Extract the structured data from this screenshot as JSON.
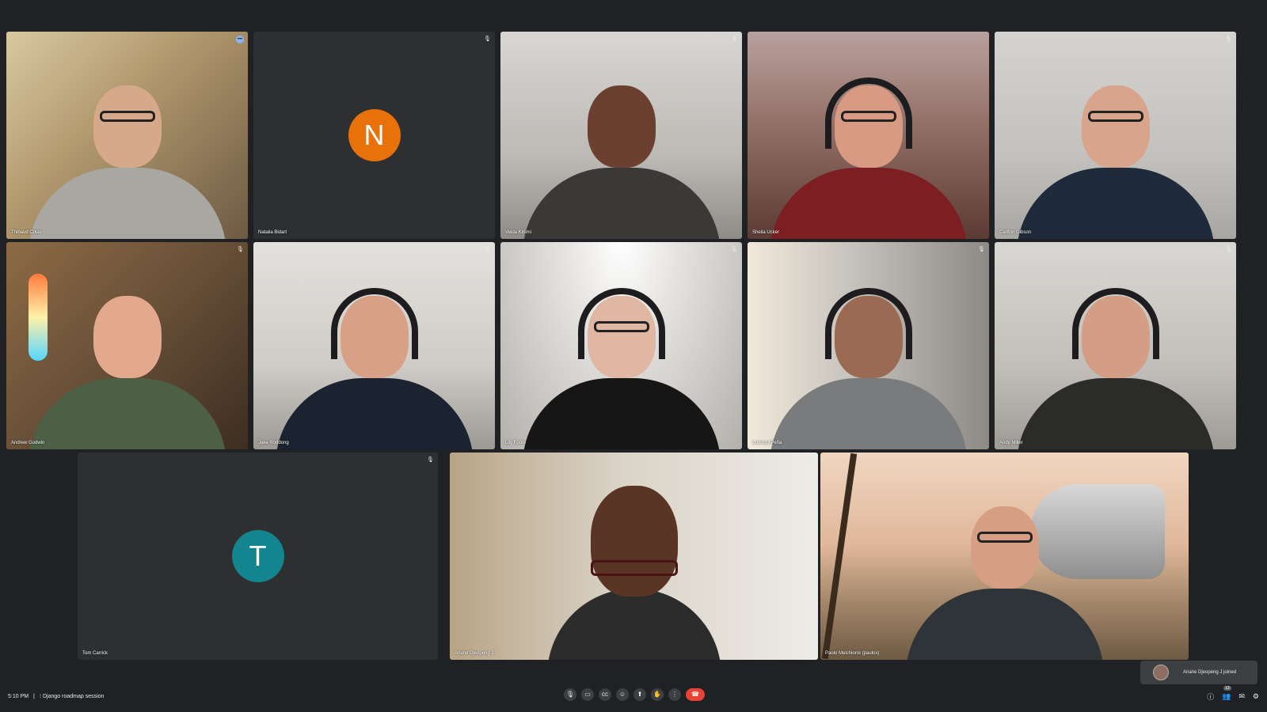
{
  "meeting": {
    "time": "5:10 PM",
    "separator": "|",
    "title": "Django roadmap session"
  },
  "participants": [
    {
      "name": "Thibaud Colas",
      "video": true
    },
    {
      "name": "Natalia Bidart",
      "video": false,
      "initial": "N",
      "avatar_color": "#e8710a"
    },
    {
      "name": "Velda Kiriimi",
      "video": true
    },
    {
      "name": "Sheila Ucker",
      "video": true
    },
    {
      "name": "Carlton Gibson",
      "video": true
    },
    {
      "name": "Andrew Godwin",
      "video": true
    },
    {
      "name": "Jake Roddong",
      "video": true
    },
    {
      "name": "Lily Foote",
      "video": true
    },
    {
      "name": "Lorenzo Peña",
      "video": true
    },
    {
      "name": "Andy Miller",
      "video": true
    },
    {
      "name": "Tom Carrick",
      "video": false,
      "initial": "T",
      "avatar_color": "#12858f"
    },
    {
      "name": "Ariane Djeopeng J",
      "video": true
    },
    {
      "name": "Paolo Melchiorre (paulox)",
      "video": true
    }
  ],
  "notification": {
    "text": "Ariane Djeopeng J joined"
  },
  "controls": {
    "mic": "mic-icon",
    "camera": "camera-icon",
    "captions": "captions-icon",
    "reactions": "emoji-icon",
    "present": "present-icon",
    "raise_hand": "hand-icon",
    "more": "more-icon",
    "end_call": "end-call-icon"
  },
  "right_controls": {
    "people_count": "13"
  }
}
